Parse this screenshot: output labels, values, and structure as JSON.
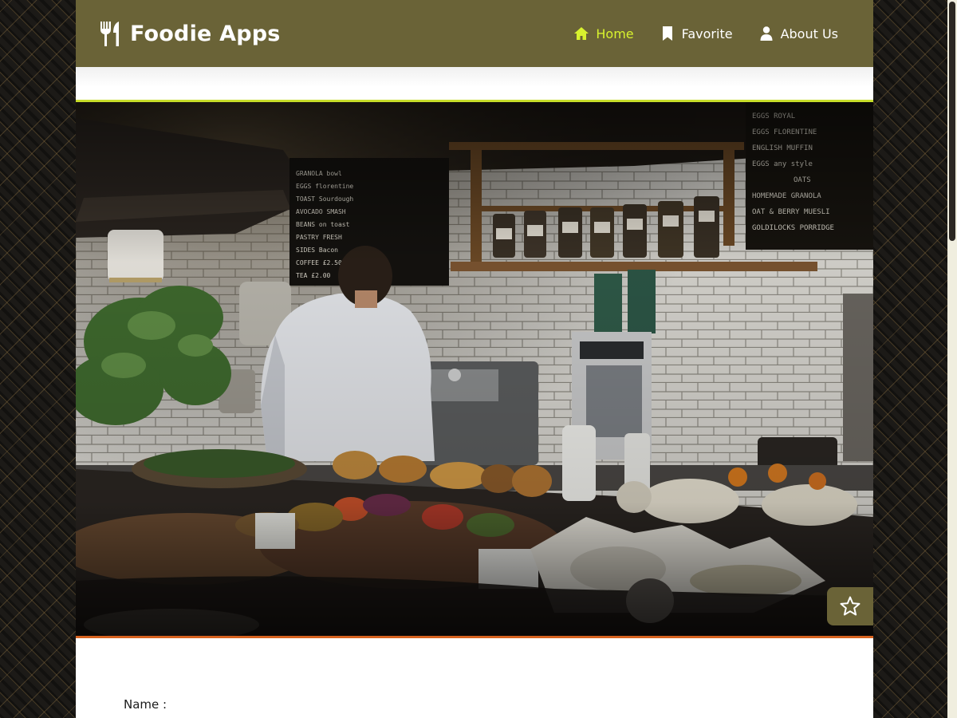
{
  "brand": {
    "name": "Foodie Apps",
    "logo_icon": "fork-knife-icon"
  },
  "nav": {
    "items": [
      {
        "label": "Home",
        "icon": "home-icon",
        "active": true
      },
      {
        "label": "Favorite",
        "icon": "bookmark-icon",
        "active": false
      },
      {
        "label": "About Us",
        "icon": "user-icon",
        "active": false
      }
    ]
  },
  "hero": {
    "image": "cafe-counter-photo",
    "favorite_icon": "star-outline-icon"
  },
  "form": {
    "name_label": "Name :"
  },
  "colors": {
    "navbar": "#6a6337",
    "active_link": "#d8f22e",
    "hero_top_border": "#c7dd2a",
    "hero_bottom_border": "#d7621f"
  }
}
